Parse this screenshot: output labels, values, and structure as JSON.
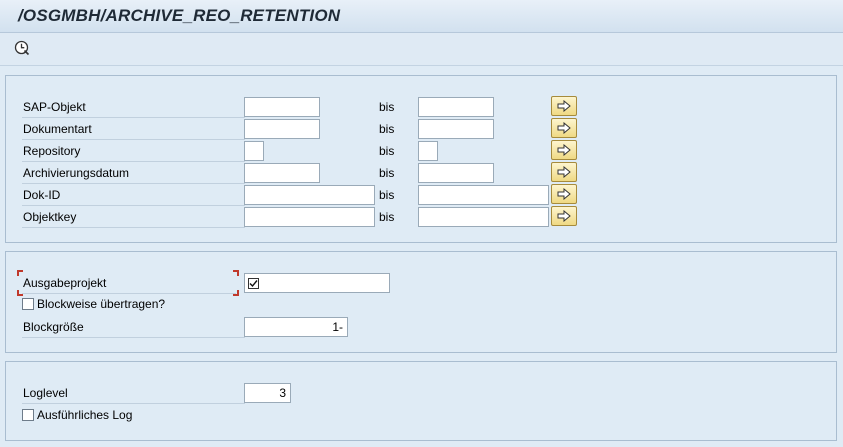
{
  "title": "/OSGMBH/ARCHIVE_REO_RETENTION",
  "toolbar": {
    "execute_icon": "execute-clock-icon"
  },
  "selection": {
    "to_label": "bis",
    "rows": [
      {
        "label": "SAP-Objekt",
        "from": "",
        "to": ""
      },
      {
        "label": "Dokumentart",
        "from": "",
        "to": ""
      },
      {
        "label": "Repository",
        "from": "",
        "to": ""
      },
      {
        "label": "Archivierungsdatum",
        "from": "",
        "to": ""
      },
      {
        "label": "Dok-ID",
        "from": "",
        "to": ""
      },
      {
        "label": "Objektkey",
        "from": "",
        "to": ""
      }
    ],
    "multi_select_icon": "arrow-right-icon"
  },
  "output": {
    "project_label": "Ausgabeprojekt",
    "project_checked": true,
    "blockwise_label": "Blockweise übertragen?",
    "blockwise_checked": false,
    "blocksize_label": "Blockgröße",
    "blocksize_value": "1-"
  },
  "logging": {
    "loglevel_label": "Loglevel",
    "loglevel_value": "3",
    "verbose_label": "Ausführliches Log",
    "verbose_checked": false
  },
  "colors": {
    "background": "#dfebf5",
    "frame_border": "#a9bdd0",
    "button_fill": "#efd984",
    "required_marker": "#c0392b"
  }
}
